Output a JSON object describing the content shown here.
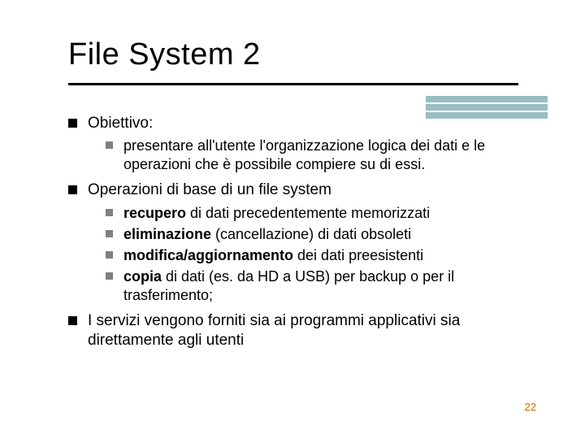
{
  "title": "File System  2",
  "bullets": {
    "b1": {
      "text": "Obiettivo:"
    },
    "b1_1": {
      "text": "presentare all'utente l'organizzazione logica dei dati e le operazioni che è possibile compiere su di essi."
    },
    "b2": {
      "text": "Operazioni di base di un file system"
    },
    "b2_1": {
      "bold": "recupero",
      "rest": " di dati precedentemente memorizzati"
    },
    "b2_2": {
      "bold": "eliminazione",
      "rest": " (cancellazione) di dati obsoleti"
    },
    "b2_3": {
      "bold": "modifica/aggiornamento",
      "rest": " dei dati preesistenti"
    },
    "b2_4": {
      "bold": "copia",
      "rest": " di dati (es. da HD a USB) per backup o per il trasferimento;"
    },
    "b3": {
      "text": "I servizi vengono forniti sia ai programmi applicativi sia direttamente agli utenti"
    }
  },
  "page_number": "22"
}
